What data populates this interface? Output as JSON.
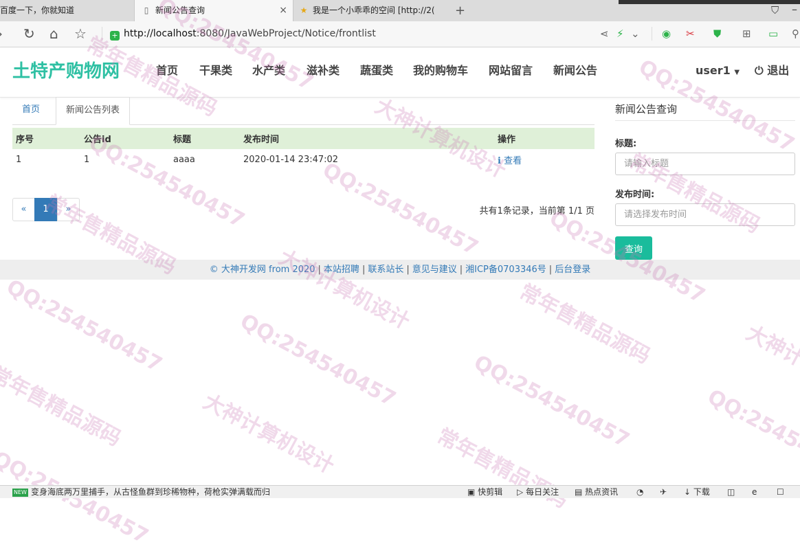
{
  "browser": {
    "tabs": [
      {
        "label": "百度一下，你就知道"
      },
      {
        "label": "新闻公告查询",
        "close": "×"
      },
      {
        "label": "我是一个小乖乖的空间 [http://2("
      }
    ],
    "new_tab": "+",
    "url_host": "http://localhost",
    "url_rest": ":8080/JavaWebProject/Notice/frontlist"
  },
  "site": {
    "brand": "土特产购物网",
    "nav": [
      "首页",
      "干果类",
      "水产类",
      "滋补类",
      "蔬蛋类",
      "我的购物车",
      "网站留言",
      "新闻公告"
    ],
    "user": "user1",
    "logout": "退出"
  },
  "breadcrumb": {
    "home": "首页",
    "current": "新闻公告列表"
  },
  "table": {
    "headers": [
      "序号",
      "公告id",
      "标题",
      "发布时间",
      "操作"
    ],
    "rows": [
      {
        "index": "1",
        "id": "1",
        "title": "aaaa",
        "time": "2020-01-14 23:47:02",
        "action": "查看"
      }
    ]
  },
  "pagination": {
    "prev": "«",
    "current": "1",
    "next": "»",
    "info": "共有1条记录，当前第 1/1 页"
  },
  "sidebar": {
    "title": "新闻公告查询",
    "title_label": "标题:",
    "title_placeholder": "请输入标题",
    "time_label": "发布时间:",
    "time_placeholder": "请选择发布时间",
    "query_button": "查询"
  },
  "footer": {
    "links": [
      "© 大神开发网 from 2020",
      "本站招聘",
      "联系站长",
      "意见与建议",
      "湘ICP备0703346号",
      "后台登录"
    ]
  },
  "watermark": {
    "texts": [
      "QQ:254540457",
      "常年售精品源码",
      "大神计算机设计"
    ]
  },
  "statusbar": {
    "badge": "NEW",
    "news": "变身海底两万里捕手，从古怪鱼群到珍稀物种，荷枪实弹满载而归",
    "items": [
      "快剪辑",
      "每日关注",
      "热点资讯",
      "下载"
    ]
  }
}
